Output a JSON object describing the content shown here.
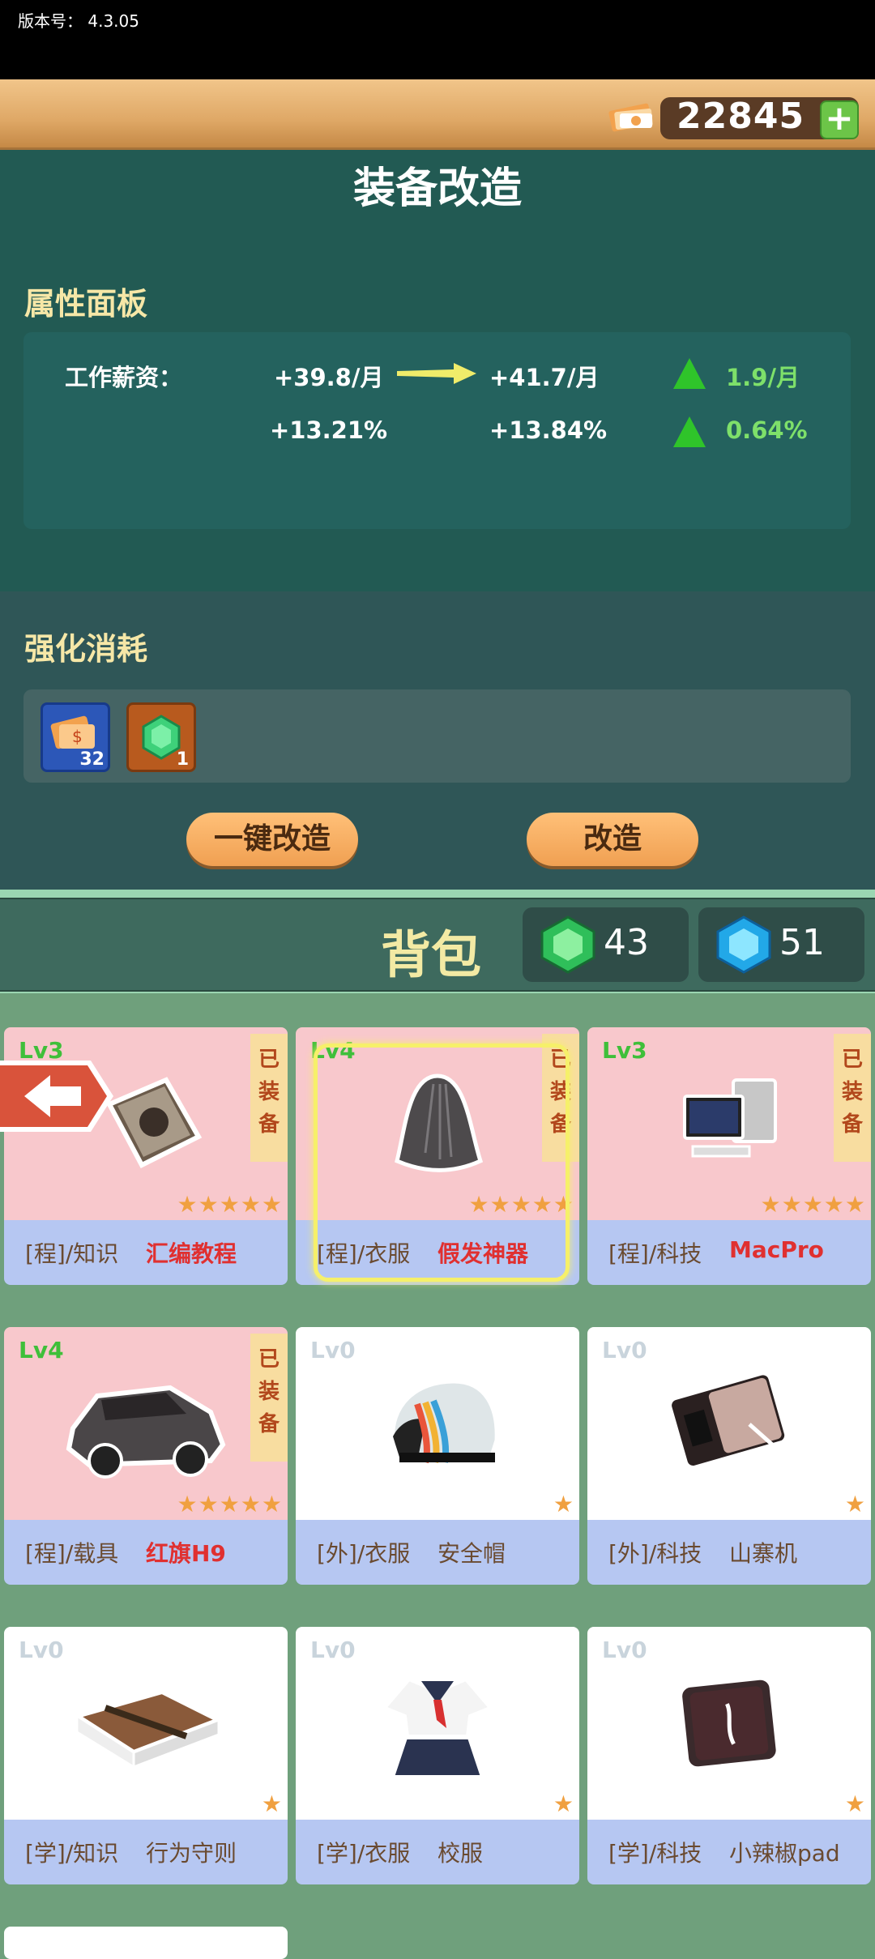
{
  "version_label": "版本号：  4.3.05",
  "currency": {
    "value": "22845"
  },
  "page_title": "装备改造",
  "attributes": {
    "section_title": "属性面板",
    "row1": {
      "label": "工作薪资：",
      "current": "+39.8/月",
      "next": "+41.7/月",
      "delta": "1.9/月"
    },
    "row2": {
      "current": "+13.21%",
      "next": "+13.84%",
      "delta": "0.64%"
    }
  },
  "cost": {
    "section_title": "强化消耗",
    "items": [
      {
        "icon": "money-stack-icon",
        "count": "32"
      },
      {
        "icon": "green-gem-icon",
        "count": "1"
      }
    ]
  },
  "buttons": {
    "one_click": "一键改造",
    "modify": "改造"
  },
  "backpack": {
    "title": "背包",
    "green_gems": "43",
    "blue_gems": "51"
  },
  "items": [
    {
      "level": "Lv3",
      "equipped": true,
      "equipped_text": "已装备",
      "stars": "★★★★★",
      "category": "[程]/知识",
      "name": "汇编教程",
      "icon": "book-icon"
    },
    {
      "level": "Lv4",
      "equipped": true,
      "equipped_text": "已装备",
      "stars": "★★★★★",
      "category": "[程]/衣服",
      "name": "假发神器",
      "icon": "wig-icon",
      "selected": true
    },
    {
      "level": "Lv3",
      "equipped": true,
      "equipped_text": "已装备",
      "stars": "★★★★★",
      "category": "[程]/科技",
      "name": "MacPro",
      "icon": "computer-icon"
    },
    {
      "level": "Lv4",
      "equipped": true,
      "equipped_text": "已装备",
      "stars": "★★★★★",
      "category": "[程]/载具",
      "name": "红旗H9",
      "icon": "car-icon"
    },
    {
      "level": "Lv0",
      "equipped": false,
      "stars": "★",
      "category": "[外]/衣服",
      "name": "安全帽",
      "icon": "helmet-icon"
    },
    {
      "level": "Lv0",
      "equipped": false,
      "stars": "★",
      "category": "[外]/科技",
      "name": "山寨机",
      "icon": "phone-icon"
    },
    {
      "level": "Lv0",
      "equipped": false,
      "stars": "★",
      "category": "[学]/知识",
      "name": "行为守则",
      "icon": "rulebook-icon"
    },
    {
      "level": "Lv0",
      "equipped": false,
      "stars": "★",
      "category": "[学]/衣服",
      "name": "校服",
      "icon": "uniform-icon"
    },
    {
      "level": "Lv0",
      "equipped": false,
      "stars": "★",
      "category": "[学]/科技",
      "name": "小辣椒pad",
      "icon": "tablet-icon"
    }
  ],
  "colors": {
    "equipped_bg": "#f8c8cc",
    "unequipped_bg": "#ffffff",
    "equipped_name": "#e03030",
    "unequipped_name": "#6a4a30"
  }
}
